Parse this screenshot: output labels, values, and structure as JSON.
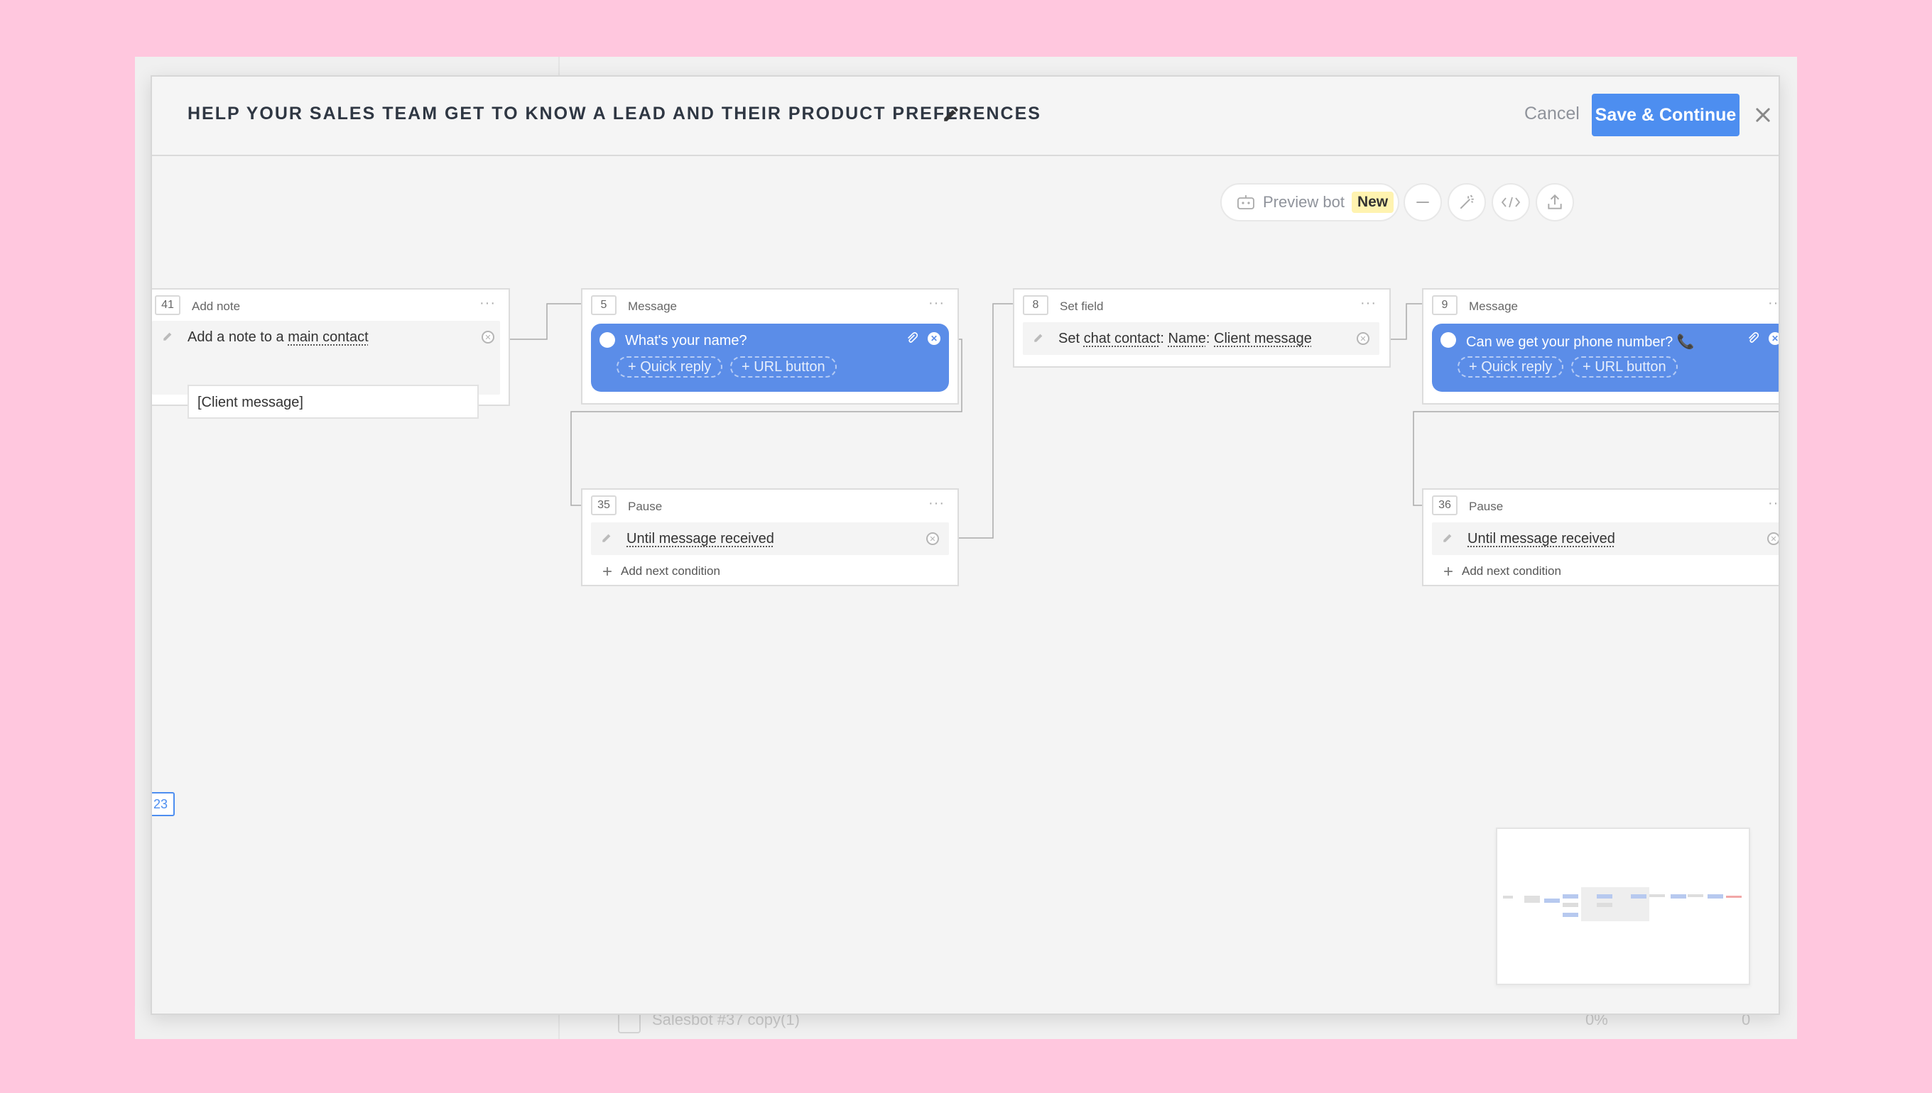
{
  "background": {
    "bottom_row": {
      "name": "Salesbot #37 copy(1)",
      "percent": "0%",
      "count_a": "0",
      "count_b": "0"
    }
  },
  "modal": {
    "title": "HELP YOUR SALES TEAM GET TO KNOW A LEAD AND THEIR PRODUCT PREFERENCES",
    "cancel_label": "Cancel",
    "save_label": "Save & Continue"
  },
  "toolbar": {
    "icons": [
      "fullscreen-icon",
      "zoom-in-icon",
      "zoom-out-icon",
      "magic-wand-icon",
      "code-icon",
      "export-icon"
    ],
    "preview_label": "Preview bot",
    "new_badge": "New"
  },
  "nodes": {
    "add_note": {
      "number": "41",
      "type": "Add note",
      "step_prefix": "Add a note to a ",
      "step_link": "main contact",
      "input_value": "[Client message]"
    },
    "message_name": {
      "number": "5",
      "type": "Message",
      "text": "What's your name?",
      "quick_reply": "+ Quick reply",
      "url_button": "+ URL button"
    },
    "set_field": {
      "number": "8",
      "type": "Set field",
      "step_prefix": "Set ",
      "entity": "chat contact",
      "colon1": ": ",
      "field": "Name",
      "colon2": ": ",
      "value": "Client message"
    },
    "message_phone": {
      "number": "9",
      "type": "Message",
      "text": "Can we get your phone number? 📞",
      "quick_reply": "+ Quick reply",
      "url_button": "+ URL button"
    },
    "pause_1": {
      "number": "35",
      "type": "Pause",
      "condition": "Until message received",
      "add_condition": "Add next condition"
    },
    "pause_2": {
      "number": "36",
      "type": "Pause",
      "condition": "Until message received",
      "add_condition": "Add next condition"
    }
  },
  "canvas": {
    "offscreen_tag": "23"
  },
  "colors": {
    "page_background": "#ffc7de",
    "accent": "#4d8ef0",
    "message_bubble": "#5b8de8",
    "new_badge": "#fff3b0"
  }
}
